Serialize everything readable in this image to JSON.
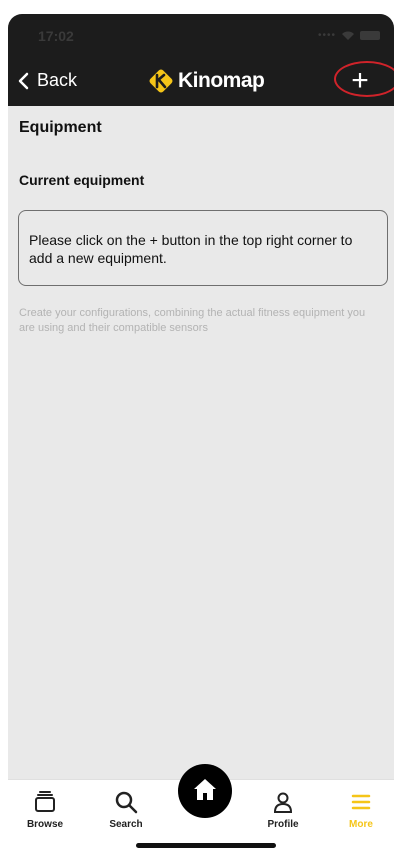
{
  "status_bar": {
    "time": "17:02"
  },
  "nav": {
    "back_label": "Back",
    "logo_text": "Kinomap",
    "add_label": "+"
  },
  "page": {
    "title": "Equipment",
    "section_title": "Current equipment",
    "empty_message": "Please click on the + button in the top right corner to add a new equipment.",
    "hint": "Create your configurations, combining the actual fitness equipment you are using and their compatible sensors"
  },
  "tab_bar": {
    "items": [
      {
        "label": "Browse",
        "icon": "browse-icon"
      },
      {
        "label": "Search",
        "icon": "search-icon"
      },
      {
        "label": "",
        "icon": "home-icon"
      },
      {
        "label": "Profile",
        "icon": "profile-icon"
      },
      {
        "label": "More",
        "icon": "menu-icon"
      }
    ]
  },
  "colors": {
    "brand_yellow": "#f5c518",
    "nav_background": "#1c1c1c",
    "content_background": "#e9e9e9",
    "highlight_red": "#d0232a"
  }
}
